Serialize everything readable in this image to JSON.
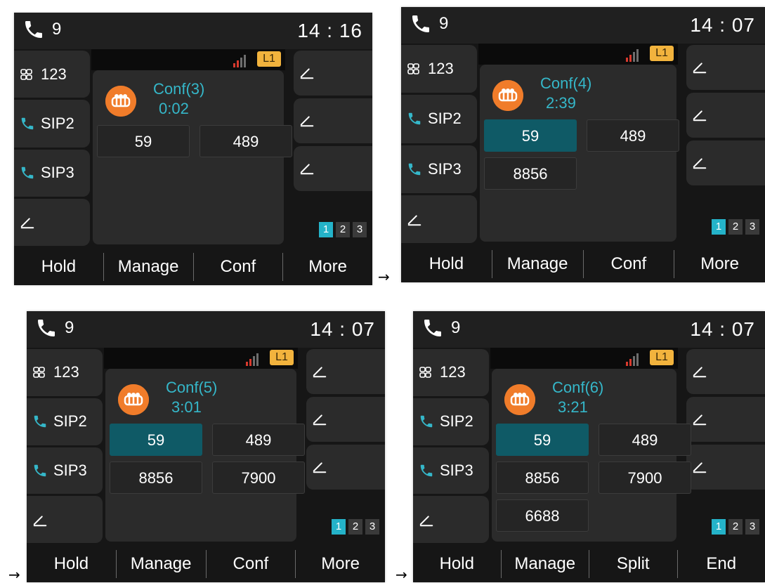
{
  "arrow_glyph": "→",
  "screens": [
    {
      "line_number": "9",
      "time": "14 : 16",
      "line_badge": "L1",
      "left_keys": [
        "123",
        "SIP2",
        "SIP3"
      ],
      "conf_title": "Conf(3)",
      "conf_time": "0:02",
      "participants": [
        "59",
        "489"
      ],
      "selected_index": -1,
      "pages": [
        "1",
        "2",
        "3"
      ],
      "softkeys": [
        "Hold",
        "Manage",
        "Conf",
        "More"
      ]
    },
    {
      "line_number": "9",
      "time": "14 : 07",
      "line_badge": "L1",
      "left_keys": [
        "123",
        "SIP2",
        "SIP3"
      ],
      "conf_title": "Conf(4)",
      "conf_time": "2:39",
      "participants": [
        "59",
        "489",
        "8856"
      ],
      "selected_index": 0,
      "pages": [
        "1",
        "2",
        "3"
      ],
      "softkeys": [
        "Hold",
        "Manage",
        "Conf",
        "More"
      ]
    },
    {
      "line_number": "9",
      "time": "14 : 07",
      "line_badge": "L1",
      "left_keys": [
        "123",
        "SIP2",
        "SIP3"
      ],
      "conf_title": "Conf(5)",
      "conf_time": "3:01",
      "participants": [
        "59",
        "489",
        "8856",
        "7900"
      ],
      "selected_index": 0,
      "pages": [
        "1",
        "2",
        "3"
      ],
      "softkeys": [
        "Hold",
        "Manage",
        "Conf",
        "More"
      ]
    },
    {
      "line_number": "9",
      "time": "14 : 07",
      "line_badge": "L1",
      "left_keys": [
        "123",
        "SIP2",
        "SIP3"
      ],
      "conf_title": "Conf(6)",
      "conf_time": "3:21",
      "participants": [
        "59",
        "489",
        "8856",
        "7900",
        "6688"
      ],
      "selected_index": 0,
      "pages": [
        "1",
        "2",
        "3"
      ],
      "softkeys": [
        "Hold",
        "Manage",
        "Split",
        "End"
      ]
    }
  ],
  "colors": {
    "accent_teal": "#35b7c9",
    "selected_participant": "#0f5a66",
    "conf_icon_orange": "#f07c2a",
    "line_badge_yellow": "#f2b33d",
    "page_active": "#24b3c9"
  }
}
